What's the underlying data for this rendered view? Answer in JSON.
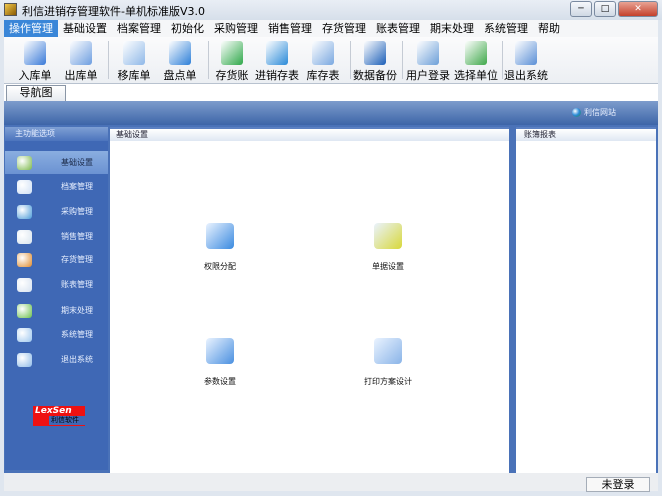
{
  "window": {
    "title": "利信进销存管理软件-单机标准版V3.0",
    "minimize": "─",
    "maximize": "□",
    "close": "✕"
  },
  "menu": [
    "操作管理",
    "基础设置",
    "档案管理",
    "初始化",
    "采购管理",
    "销售管理",
    "存货管理",
    "账表管理",
    "期末处理",
    "系统管理",
    "帮助"
  ],
  "toolbar": [
    {
      "label": "入库单",
      "icon": "stock-in-icon",
      "color": "#3a7ad8"
    },
    {
      "label": "出库单",
      "icon": "stock-out-icon",
      "color": "#6d9ee0"
    },
    {
      "label": "移库单",
      "icon": "transfer-search-icon",
      "color": "#8fb8e8"
    },
    {
      "label": "盘点单",
      "icon": "inventory-gear-icon",
      "color": "#2d7fd8"
    },
    {
      "label": "存货账",
      "icon": "ledger-icon",
      "color": "#2fa84a"
    },
    {
      "label": "进销存表",
      "icon": "pie-report-icon",
      "color": "#2a8ad8"
    },
    {
      "label": "库存表",
      "icon": "stock-report-icon",
      "color": "#7aa8e0"
    },
    {
      "label": "数据备份",
      "icon": "floppy-backup-icon",
      "color": "#1c5fb8"
    },
    {
      "label": "用户登录",
      "icon": "user-login-icon",
      "color": "#6c9fd8"
    },
    {
      "label": "选择单位",
      "icon": "folder-select-icon",
      "color": "#3fa84a"
    },
    {
      "label": "退出系统",
      "icon": "exit-lock-icon",
      "color": "#5a8fd6"
    }
  ],
  "tab": "导航图",
  "site_link": "利信网站",
  "left_panel": {
    "title": "主功能选项",
    "selected": 0,
    "items": [
      {
        "label": "基础设置",
        "color": "#7bb84a"
      },
      {
        "label": "档案管理",
        "color": "#cfe0f5"
      },
      {
        "label": "采购管理",
        "color": "#4a9ad8"
      },
      {
        "label": "销售管理",
        "color": "#d8e4ee"
      },
      {
        "label": "存货管理",
        "color": "#e08a2a"
      },
      {
        "label": "账表管理",
        "color": "#d6e2f0"
      },
      {
        "label": "期末处理",
        "color": "#6ac04a"
      },
      {
        "label": "系统管理",
        "color": "#9cc6ee"
      },
      {
        "label": "退出系统",
        "color": "#8fbbe8"
      }
    ]
  },
  "logo": {
    "line1": "LexSen",
    "line2": "利信软件"
  },
  "center": {
    "title": "基础设置",
    "items": [
      {
        "label": "权限分配",
        "icon": "permission-icon",
        "color": "#3a8ae0"
      },
      {
        "label": "单据设置",
        "icon": "document-settings-icon",
        "color": "#d8d83a"
      },
      {
        "label": "参数设置",
        "icon": "parameter-settings-icon",
        "color": "#4a90e0"
      },
      {
        "label": "打印方案设计",
        "icon": "print-design-icon",
        "color": "#8ab4e8"
      }
    ]
  },
  "right": {
    "title": "账簿报表"
  },
  "status": "未登录"
}
